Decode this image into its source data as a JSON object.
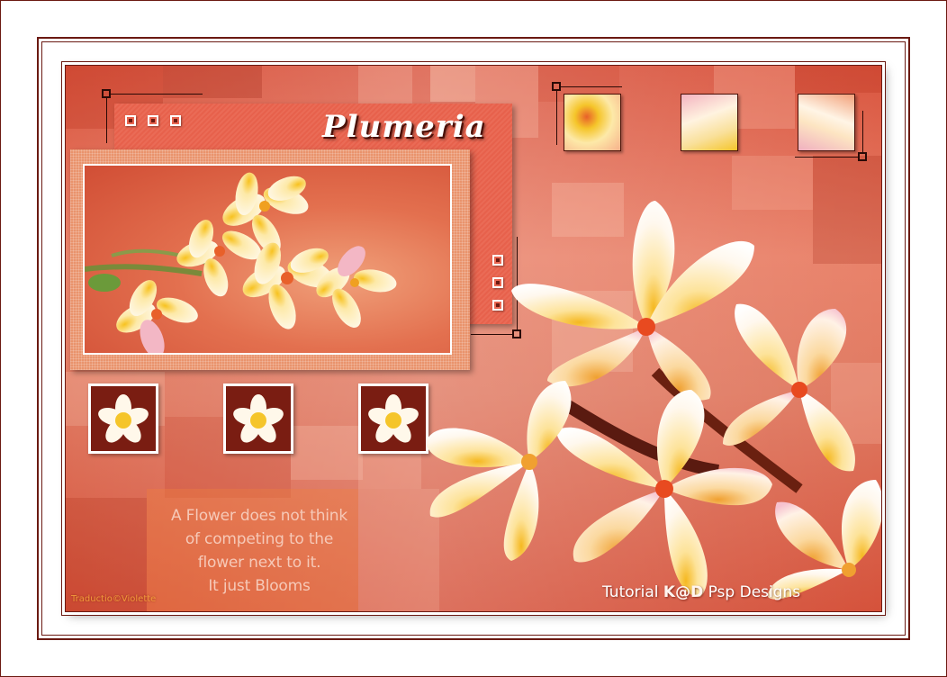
{
  "title": "Plumeria",
  "quote_lines": [
    "A Flower does not think",
    "of competing to the",
    "flower next to it.",
    "It just Blooms"
  ],
  "credit_left": "Traductio©Violette",
  "credit_right": {
    "prefix": "Tutorial",
    "logo": "K@D",
    "suffix": "Psp Designs"
  },
  "colors": {
    "frame": "#6b1a12",
    "background": "#e07a62",
    "petal": "#fff8ea",
    "petal_center": "#f5c52a",
    "petal_blush": "#e8809a",
    "tile_dark": "#7a1d12"
  },
  "icons": {
    "top_left_buttons": [
      "square-button",
      "square-button",
      "square-button"
    ],
    "side_buttons": [
      "square-button",
      "square-button",
      "square-button"
    ]
  }
}
